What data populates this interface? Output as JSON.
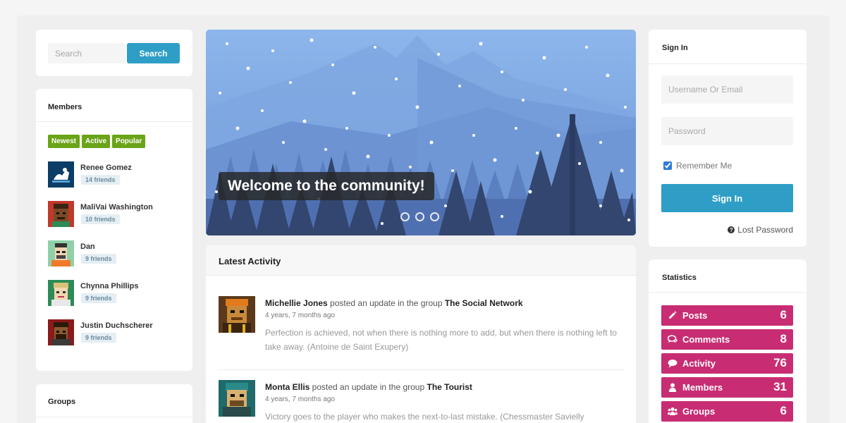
{
  "search": {
    "placeholder": "Search",
    "button_label": "Search"
  },
  "members": {
    "title": "Members",
    "tabs": [
      "Newest",
      "Active",
      "Popular"
    ],
    "list": [
      {
        "name": "Renee Gomez",
        "friends": "14 friends"
      },
      {
        "name": "MaliVai Washington",
        "friends": "10 friends"
      },
      {
        "name": "Dan",
        "friends": "9 friends"
      },
      {
        "name": "Chynna Phillips",
        "friends": "9 friends"
      },
      {
        "name": "Justin Duchscherer",
        "friends": "9 friends"
      }
    ]
  },
  "groups": {
    "title": "Groups"
  },
  "hero": {
    "caption": "Welcome to the community!",
    "slide_count": 3
  },
  "activity": {
    "title": "Latest Activity",
    "items": [
      {
        "user": "Michellie Jones",
        "action": " posted an update in the group ",
        "group": "The Social Network",
        "time": "4 years, 7 months ago",
        "text": "Perfection is achieved, not when there is nothing more to add, but when there is nothing left to take away. (Antoine de Saint Exupery)"
      },
      {
        "user": "Monta Ellis",
        "action": " posted an update in the group ",
        "group": "The Tourist",
        "time": "4 years, 7 months ago",
        "text": "Victory goes to the player who makes the next-to-last mistake. (Chessmaster Savielly Tartakower)"
      }
    ]
  },
  "signin": {
    "title": "Sign In",
    "username_placeholder": "Username Or Email",
    "password_placeholder": "Password",
    "remember_label": "Remember Me",
    "remember_checked": true,
    "button_label": "Sign In",
    "lost_label": "Lost Password"
  },
  "statistics": {
    "title": "Statistics",
    "items": [
      {
        "label": "Posts",
        "value": "6",
        "icon": "pencil-icon"
      },
      {
        "label": "Comments",
        "value": "8",
        "icon": "comments-icon"
      },
      {
        "label": "Activity",
        "value": "76",
        "icon": "comment-icon"
      },
      {
        "label": "Members",
        "value": "31",
        "icon": "user-icon"
      },
      {
        "label": "Groups",
        "value": "6",
        "icon": "users-icon"
      }
    ]
  },
  "colors": {
    "accent": "#2e9ec6",
    "tab_green": "#6aa418",
    "stat_pink": "#c82d73"
  }
}
